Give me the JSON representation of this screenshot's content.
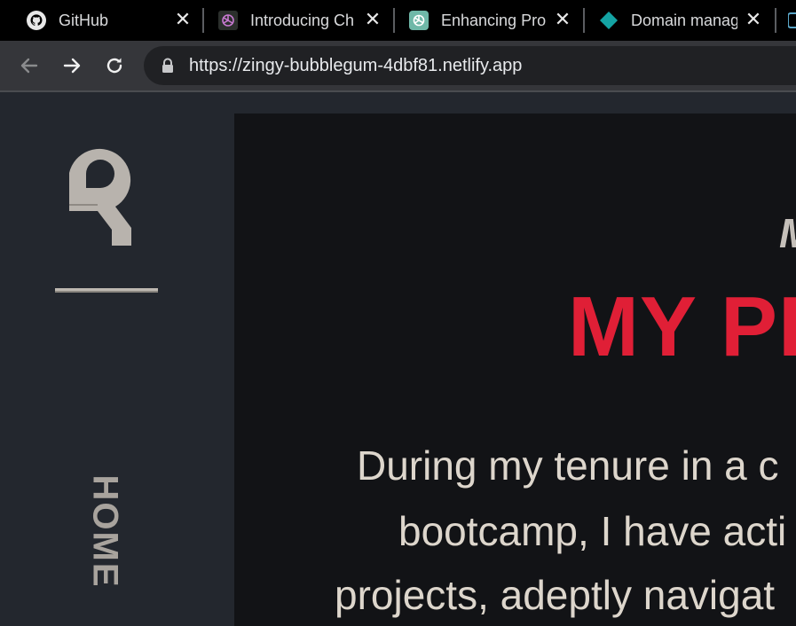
{
  "browser": {
    "tabs": [
      {
        "title": "GitHub",
        "icon": "github-icon"
      },
      {
        "title": "Introducing Ch",
        "icon": "openai-icon"
      },
      {
        "title": "Enhancing Prof",
        "icon": "chatgpt-icon"
      },
      {
        "title": "Domain manag",
        "icon": "netlify-diamond-icon"
      }
    ],
    "close_glyph": "✕",
    "url": "https://zingy-bubblegum-4dbf81.netlify.app"
  },
  "page": {
    "nav_label": "HOME",
    "eyebrow": "M",
    "headline": "MY PR",
    "paragraph_lines": [
      "During my tenure in a c",
      "bootcamp, I have acti",
      "projects, adeptly navigat"
    ]
  },
  "colors": {
    "accent_red": "#e01f36",
    "logo_gray": "#b8b3ad",
    "text_light": "#ddd6cc",
    "sidebar_bg": "#23272e",
    "main_bg": "#121316"
  }
}
